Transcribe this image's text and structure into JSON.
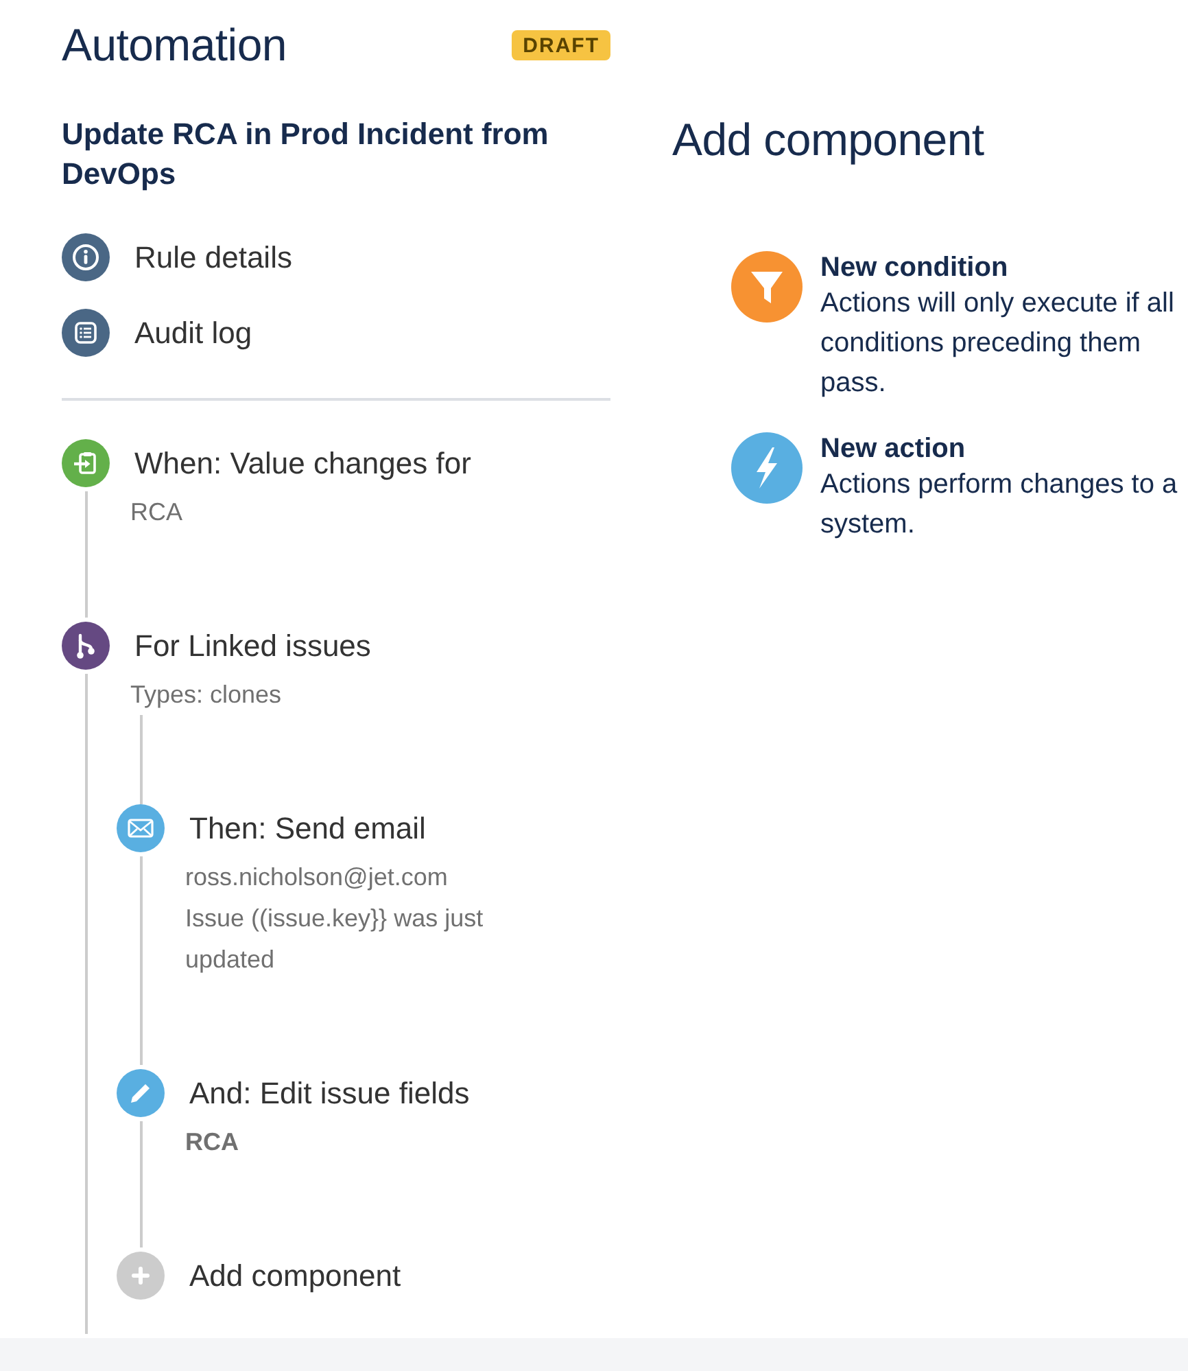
{
  "header": {
    "title": "Automation",
    "badge": "DRAFT"
  },
  "rule": {
    "name": "Update RCA in Prod Incident from DevOps"
  },
  "nav": [
    {
      "kind": "details",
      "label": "Rule details"
    },
    {
      "kind": "audit",
      "label": "Audit log"
    }
  ],
  "flow": [
    {
      "kind": "trigger",
      "title": "When: Value changes for",
      "details": [
        "RCA"
      ]
    },
    {
      "kind": "branch",
      "title": "For Linked issues",
      "details": [
        "Types: clones"
      ],
      "children": [
        {
          "kind": "email",
          "title": "Then: Send email",
          "details": [
            "ross.nicholson@jet.com",
            "Issue ((issue.key}} was just updated"
          ]
        },
        {
          "kind": "edit",
          "title": "And: Edit issue fields",
          "details": [
            "RCA"
          ]
        },
        {
          "kind": "add",
          "title": "Add component"
        }
      ]
    }
  ],
  "panel": {
    "title": "Add component",
    "options": [
      {
        "kind": "condition",
        "title": "New condition",
        "description": "Actions will only execute if all conditions preceding them pass."
      },
      {
        "kind": "action",
        "title": "New action",
        "description": "Actions perform changes to a system."
      }
    ]
  }
}
